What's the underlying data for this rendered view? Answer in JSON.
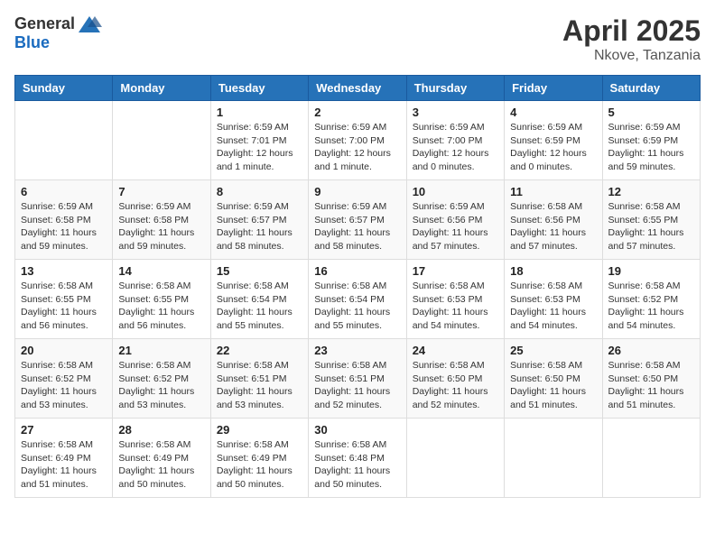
{
  "header": {
    "logo_general": "General",
    "logo_blue": "Blue",
    "title": "April 2025",
    "location": "Nkove, Tanzania"
  },
  "weekdays": [
    "Sunday",
    "Monday",
    "Tuesday",
    "Wednesday",
    "Thursday",
    "Friday",
    "Saturday"
  ],
  "weeks": [
    [
      {
        "day": "",
        "info": ""
      },
      {
        "day": "",
        "info": ""
      },
      {
        "day": "1",
        "info": "Sunrise: 6:59 AM\nSunset: 7:01 PM\nDaylight: 12 hours and 1 minute."
      },
      {
        "day": "2",
        "info": "Sunrise: 6:59 AM\nSunset: 7:00 PM\nDaylight: 12 hours and 1 minute."
      },
      {
        "day": "3",
        "info": "Sunrise: 6:59 AM\nSunset: 7:00 PM\nDaylight: 12 hours and 0 minutes."
      },
      {
        "day": "4",
        "info": "Sunrise: 6:59 AM\nSunset: 6:59 PM\nDaylight: 12 hours and 0 minutes."
      },
      {
        "day": "5",
        "info": "Sunrise: 6:59 AM\nSunset: 6:59 PM\nDaylight: 11 hours and 59 minutes."
      }
    ],
    [
      {
        "day": "6",
        "info": "Sunrise: 6:59 AM\nSunset: 6:58 PM\nDaylight: 11 hours and 59 minutes."
      },
      {
        "day": "7",
        "info": "Sunrise: 6:59 AM\nSunset: 6:58 PM\nDaylight: 11 hours and 59 minutes."
      },
      {
        "day": "8",
        "info": "Sunrise: 6:59 AM\nSunset: 6:57 PM\nDaylight: 11 hours and 58 minutes."
      },
      {
        "day": "9",
        "info": "Sunrise: 6:59 AM\nSunset: 6:57 PM\nDaylight: 11 hours and 58 minutes."
      },
      {
        "day": "10",
        "info": "Sunrise: 6:59 AM\nSunset: 6:56 PM\nDaylight: 11 hours and 57 minutes."
      },
      {
        "day": "11",
        "info": "Sunrise: 6:58 AM\nSunset: 6:56 PM\nDaylight: 11 hours and 57 minutes."
      },
      {
        "day": "12",
        "info": "Sunrise: 6:58 AM\nSunset: 6:55 PM\nDaylight: 11 hours and 57 minutes."
      }
    ],
    [
      {
        "day": "13",
        "info": "Sunrise: 6:58 AM\nSunset: 6:55 PM\nDaylight: 11 hours and 56 minutes."
      },
      {
        "day": "14",
        "info": "Sunrise: 6:58 AM\nSunset: 6:55 PM\nDaylight: 11 hours and 56 minutes."
      },
      {
        "day": "15",
        "info": "Sunrise: 6:58 AM\nSunset: 6:54 PM\nDaylight: 11 hours and 55 minutes."
      },
      {
        "day": "16",
        "info": "Sunrise: 6:58 AM\nSunset: 6:54 PM\nDaylight: 11 hours and 55 minutes."
      },
      {
        "day": "17",
        "info": "Sunrise: 6:58 AM\nSunset: 6:53 PM\nDaylight: 11 hours and 54 minutes."
      },
      {
        "day": "18",
        "info": "Sunrise: 6:58 AM\nSunset: 6:53 PM\nDaylight: 11 hours and 54 minutes."
      },
      {
        "day": "19",
        "info": "Sunrise: 6:58 AM\nSunset: 6:52 PM\nDaylight: 11 hours and 54 minutes."
      }
    ],
    [
      {
        "day": "20",
        "info": "Sunrise: 6:58 AM\nSunset: 6:52 PM\nDaylight: 11 hours and 53 minutes."
      },
      {
        "day": "21",
        "info": "Sunrise: 6:58 AM\nSunset: 6:52 PM\nDaylight: 11 hours and 53 minutes."
      },
      {
        "day": "22",
        "info": "Sunrise: 6:58 AM\nSunset: 6:51 PM\nDaylight: 11 hours and 53 minutes."
      },
      {
        "day": "23",
        "info": "Sunrise: 6:58 AM\nSunset: 6:51 PM\nDaylight: 11 hours and 52 minutes."
      },
      {
        "day": "24",
        "info": "Sunrise: 6:58 AM\nSunset: 6:50 PM\nDaylight: 11 hours and 52 minutes."
      },
      {
        "day": "25",
        "info": "Sunrise: 6:58 AM\nSunset: 6:50 PM\nDaylight: 11 hours and 51 minutes."
      },
      {
        "day": "26",
        "info": "Sunrise: 6:58 AM\nSunset: 6:50 PM\nDaylight: 11 hours and 51 minutes."
      }
    ],
    [
      {
        "day": "27",
        "info": "Sunrise: 6:58 AM\nSunset: 6:49 PM\nDaylight: 11 hours and 51 minutes."
      },
      {
        "day": "28",
        "info": "Sunrise: 6:58 AM\nSunset: 6:49 PM\nDaylight: 11 hours and 50 minutes."
      },
      {
        "day": "29",
        "info": "Sunrise: 6:58 AM\nSunset: 6:49 PM\nDaylight: 11 hours and 50 minutes."
      },
      {
        "day": "30",
        "info": "Sunrise: 6:58 AM\nSunset: 6:48 PM\nDaylight: 11 hours and 50 minutes."
      },
      {
        "day": "",
        "info": ""
      },
      {
        "day": "",
        "info": ""
      },
      {
        "day": "",
        "info": ""
      }
    ]
  ]
}
